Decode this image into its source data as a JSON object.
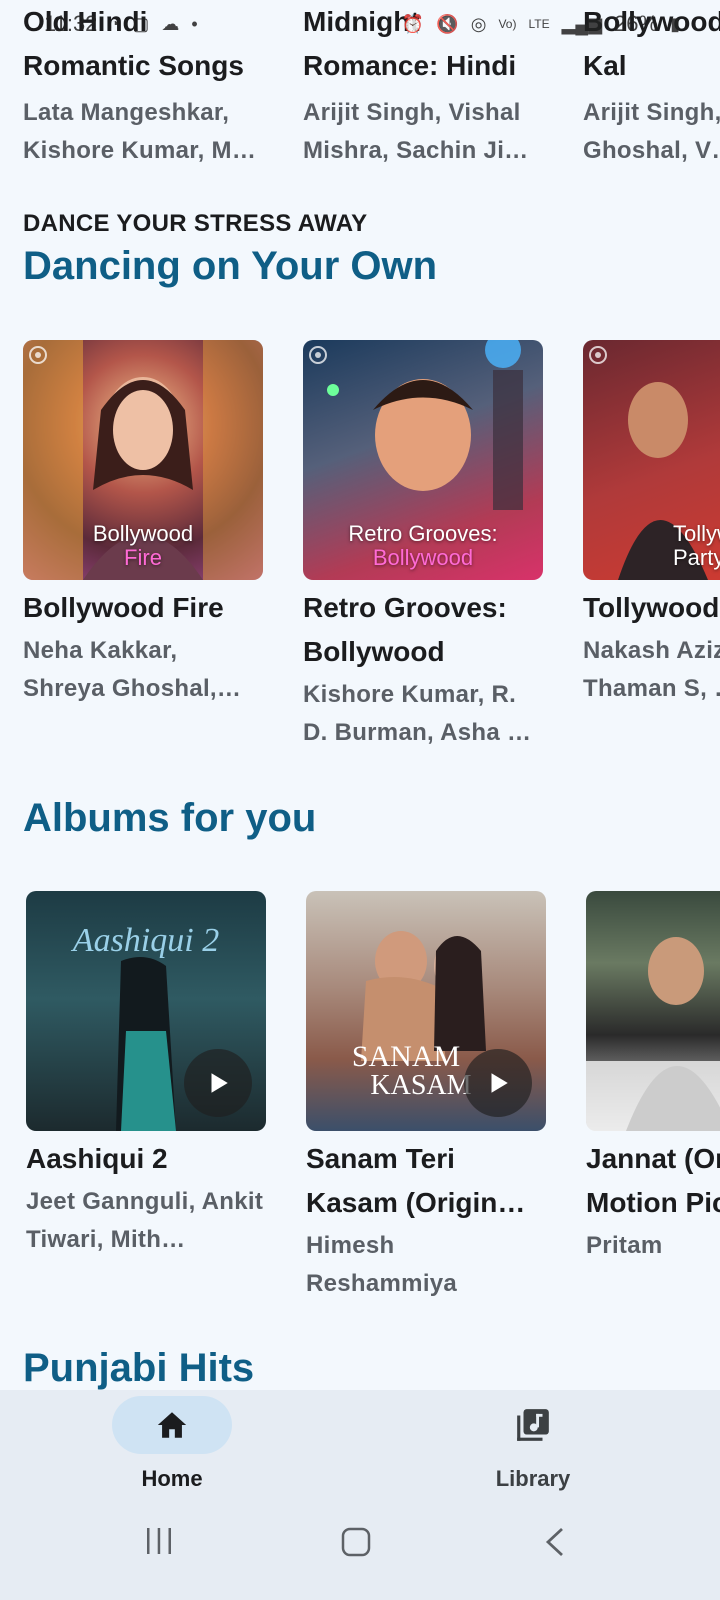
{
  "status_bar": {
    "time": "11:32",
    "battery": "26%"
  },
  "top_row": {
    "cards": [
      {
        "title": "Old Hindi Romantic Songs",
        "subtitle": "Lata Mangeshkar, Kishore Kumar, M…"
      },
      {
        "title": "Midnight Romance: Hindi",
        "subtitle": "Arijit Singh, Vishal Mishra, Sachin Ji…"
      },
      {
        "title": "Bollywood Aaj Kal",
        "subtitle": "Arijit Singh, Shreya Ghoshal, V…"
      }
    ]
  },
  "dancing_section": {
    "eyebrow": "DANCE YOUR STRESS AWAY",
    "title": "Dancing on Your Own",
    "cards": [
      {
        "art_line1": "Bollywood",
        "art_line2": "Fire",
        "title": "Bollywood Fire",
        "subtitle": "Neha Kakkar, Shreya Ghoshal, S…"
      },
      {
        "art_line1": "Retro Grooves:",
        "art_line2": "Bollywood",
        "title": "Retro Grooves: Bollywood",
        "subtitle": "Kishore Kumar, R. D. Burman, Asha …"
      },
      {
        "art_line1": "Tollywood",
        "art_line2": "Party",
        "title": "Tollywood Party",
        "subtitle": "Nakash Aziz, Thaman S, …"
      }
    ]
  },
  "albums_section": {
    "title": "Albums for you",
    "cards": [
      {
        "title": "Aashiqui 2",
        "subtitle": "Jeet Gannguli, Ankit Tiwari, Mith…"
      },
      {
        "title": "Sanam Teri Kasam (Origin…",
        "subtitle": "Himesh Reshammiya"
      },
      {
        "title": "Jannat (Original Motion Picture…",
        "subtitle": "Pritam"
      }
    ]
  },
  "next_section": {
    "title": "Punjabi Hits"
  },
  "bottom_nav": {
    "home_label": "Home",
    "library_label": "Library"
  },
  "colors": {
    "accent": "#0f5e86",
    "nav_active": "#cfe3f3",
    "background": "#f3f8fd"
  }
}
